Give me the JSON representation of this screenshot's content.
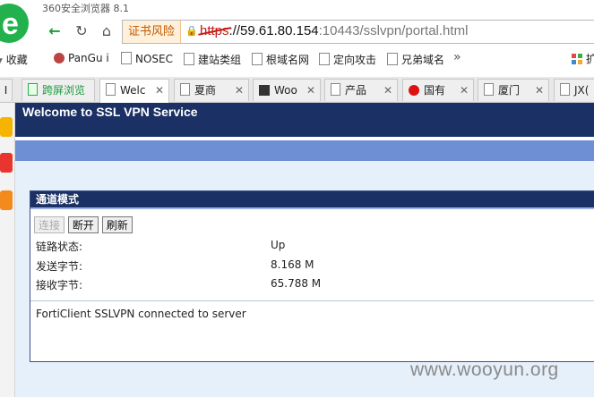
{
  "browser": {
    "app_title": "360安全浏览器 8.1",
    "cert_warning": "证书风险",
    "url_scheme": "https",
    "url_sep": "://",
    "url_host": "59.61.80.154",
    "url_rest": ":10443/sslvpn/portal.html"
  },
  "bookmarks": [
    {
      "label": "收藏"
    },
    {
      "label": "PanGu i"
    },
    {
      "label": "NOSEC"
    },
    {
      "label": "建站类组"
    },
    {
      "label": "根域名网"
    },
    {
      "label": "定向攻击"
    },
    {
      "label": "兄弟域名"
    },
    {
      "label": "扩"
    }
  ],
  "bookmarks_more": "»",
  "tabs": [
    {
      "label": "I"
    },
    {
      "label": "跨屏浏览"
    },
    {
      "label": "Welc"
    },
    {
      "label": "夏商"
    },
    {
      "label": "Woo"
    },
    {
      "label": "产品"
    },
    {
      "label": "国有"
    },
    {
      "label": "厦门"
    },
    {
      "label": "JX("
    }
  ],
  "page": {
    "banner_title": "Welcome to SSL VPN Service",
    "panel_title": "通道模式",
    "buttons": {
      "connect": "连接",
      "disconnect": "断开",
      "refresh": "刷新"
    },
    "link_status_label": "链路状态:",
    "link_status_value": "Up",
    "bytes_sent_label": "发送字节:",
    "bytes_sent_value": "8.168 M",
    "bytes_recv_label": "接收字节:",
    "bytes_recv_value": "65.788 M",
    "message": "FortiClient SSLVPN connected to server"
  },
  "watermark": "www.wooyun.org",
  "colors": {
    "banner": "#1b3064",
    "band": "#6f8fd4",
    "page_bg": "#e6f0fb",
    "cert_warning": "#c05a00",
    "url_scheme": "#c41a16"
  }
}
